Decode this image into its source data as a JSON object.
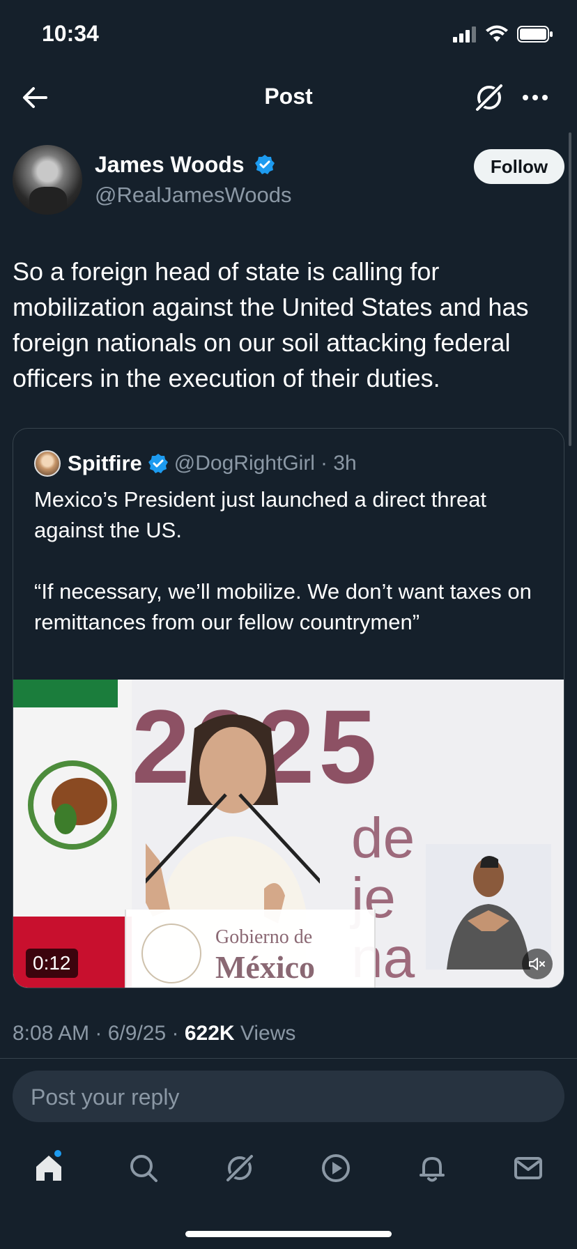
{
  "status": {
    "time": "10:34"
  },
  "nav": {
    "title": "Post"
  },
  "author": {
    "name": "James Woods",
    "handle": "@RealJamesWoods",
    "follow_label": "Follow"
  },
  "post": {
    "text": "So a foreign head of state is calling for mobilization against the United States and has foreign nationals on our soil attacking federal officers in the execution of their duties."
  },
  "quote": {
    "name": "Spitfire",
    "handle": "@DogRightGirl",
    "time": "· 3h",
    "text": "Mexico’s President just launched a direct threat against the US.\n\n“If necessary, we’ll mobilize. We don’t want taxes on remittances from our fellow countrymen”",
    "video": {
      "duration": "0:12",
      "backdrop_year": "2025",
      "backdrop_text": "de\nje\nna",
      "podium_line1": "Gobierno de",
      "podium_line2": "México"
    }
  },
  "meta": {
    "time": "8:08 AM",
    "date": "6/9/25",
    "views_count": "622K",
    "views_label": "Views"
  },
  "reply": {
    "placeholder": "Post your reply"
  },
  "colors": {
    "verified": "#1d9bf0",
    "background": "#15202b",
    "accent": "#1d9bf0"
  },
  "tabs": [
    "home-icon",
    "search-icon",
    "grok-icon",
    "video-icon",
    "bell-icon",
    "mail-icon"
  ]
}
